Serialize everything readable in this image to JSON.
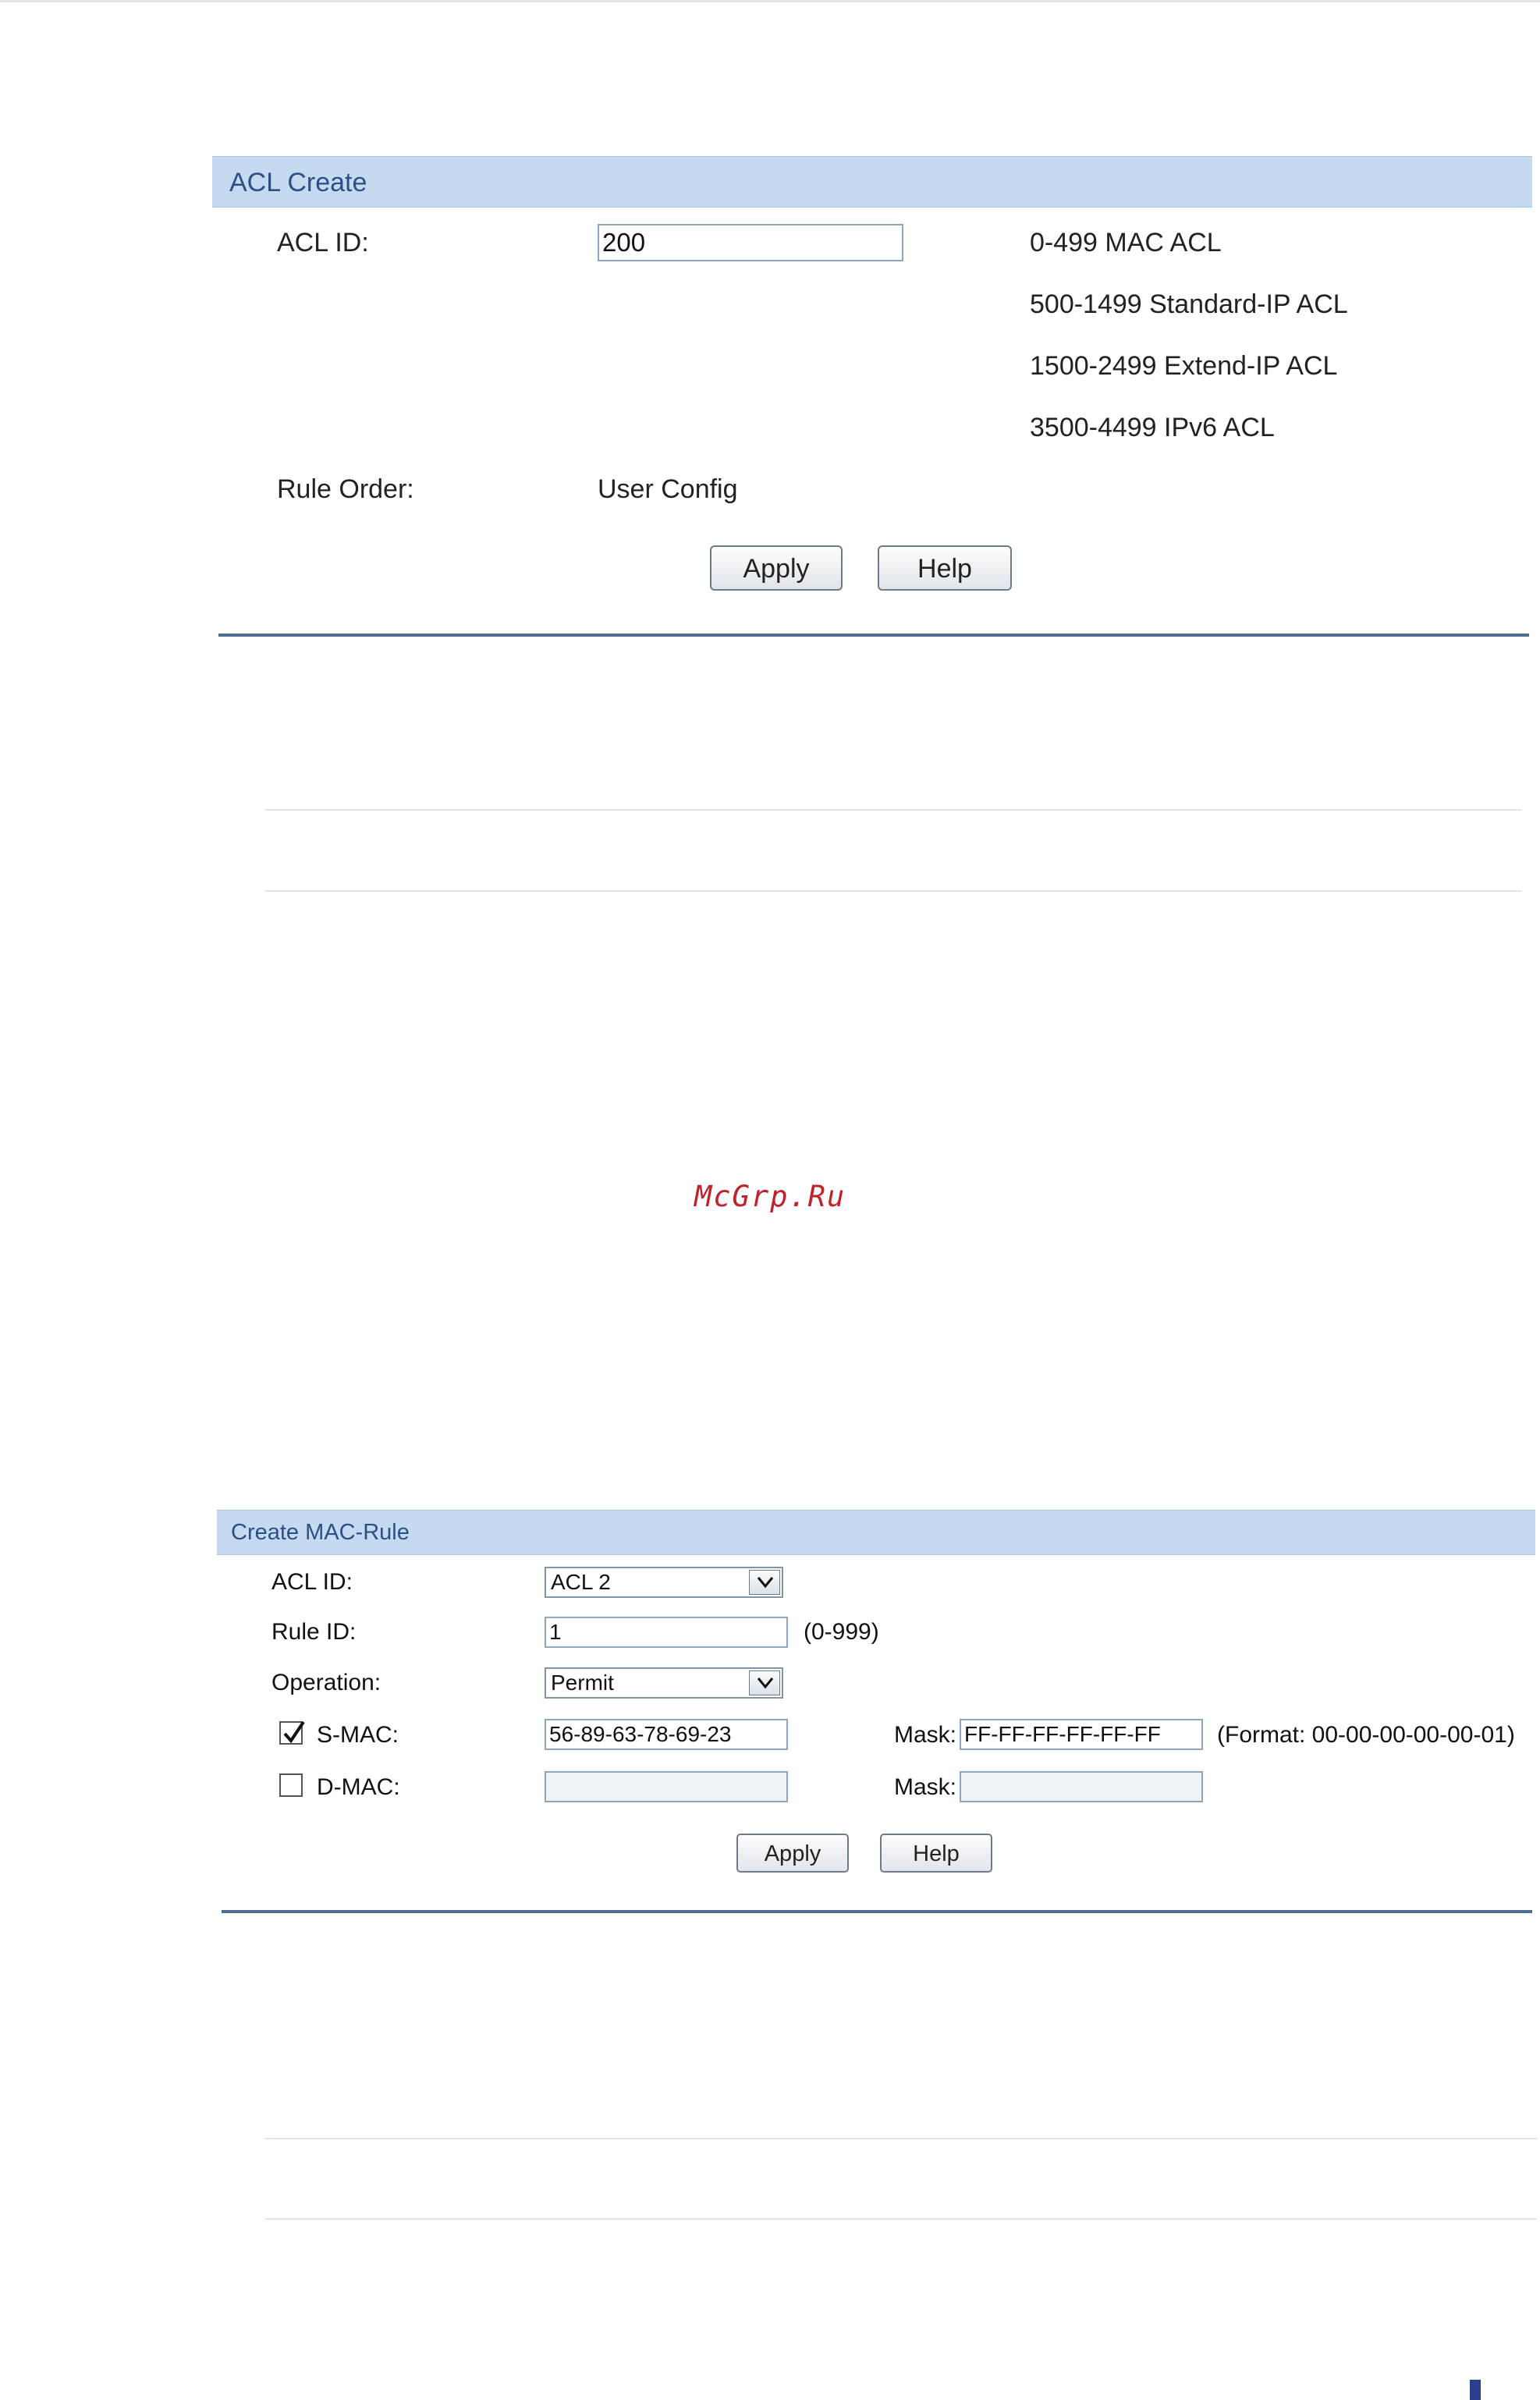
{
  "acl_create": {
    "title": "ACL Create",
    "acl_id_label": "ACL ID:",
    "acl_id_value": "200",
    "notes": [
      "0-499 MAC ACL",
      "500-1499 Standard-IP ACL",
      "1500-2499 Extend-IP ACL",
      "3500-4499 IPv6 ACL"
    ],
    "rule_order_label": "Rule Order:",
    "rule_order_value": "User Config",
    "apply_label": "Apply",
    "help_label": "Help"
  },
  "watermark": "McGrp.Ru",
  "mac_rule": {
    "title": "Create MAC-Rule",
    "acl_id_label": "ACL ID:",
    "acl_id_selected": "ACL 2",
    "rule_id_label": "Rule ID:",
    "rule_id_value": "1",
    "rule_id_hint": "(0-999)",
    "operation_label": "Operation:",
    "operation_selected": "Permit",
    "smac_label": "S-MAC:",
    "smac_checked": true,
    "smac_value": "56-89-63-78-69-23",
    "smac_mask_label": "Mask:",
    "smac_mask_value": "FF-FF-FF-FF-FF-FF",
    "smac_format_hint": "(Format: 00-00-00-00-00-01)",
    "dmac_label": "D-MAC:",
    "dmac_checked": false,
    "dmac_value": "",
    "dmac_mask_label": "Mask:",
    "dmac_mask_value": "",
    "apply_label": "Apply",
    "help_label": "Help"
  }
}
